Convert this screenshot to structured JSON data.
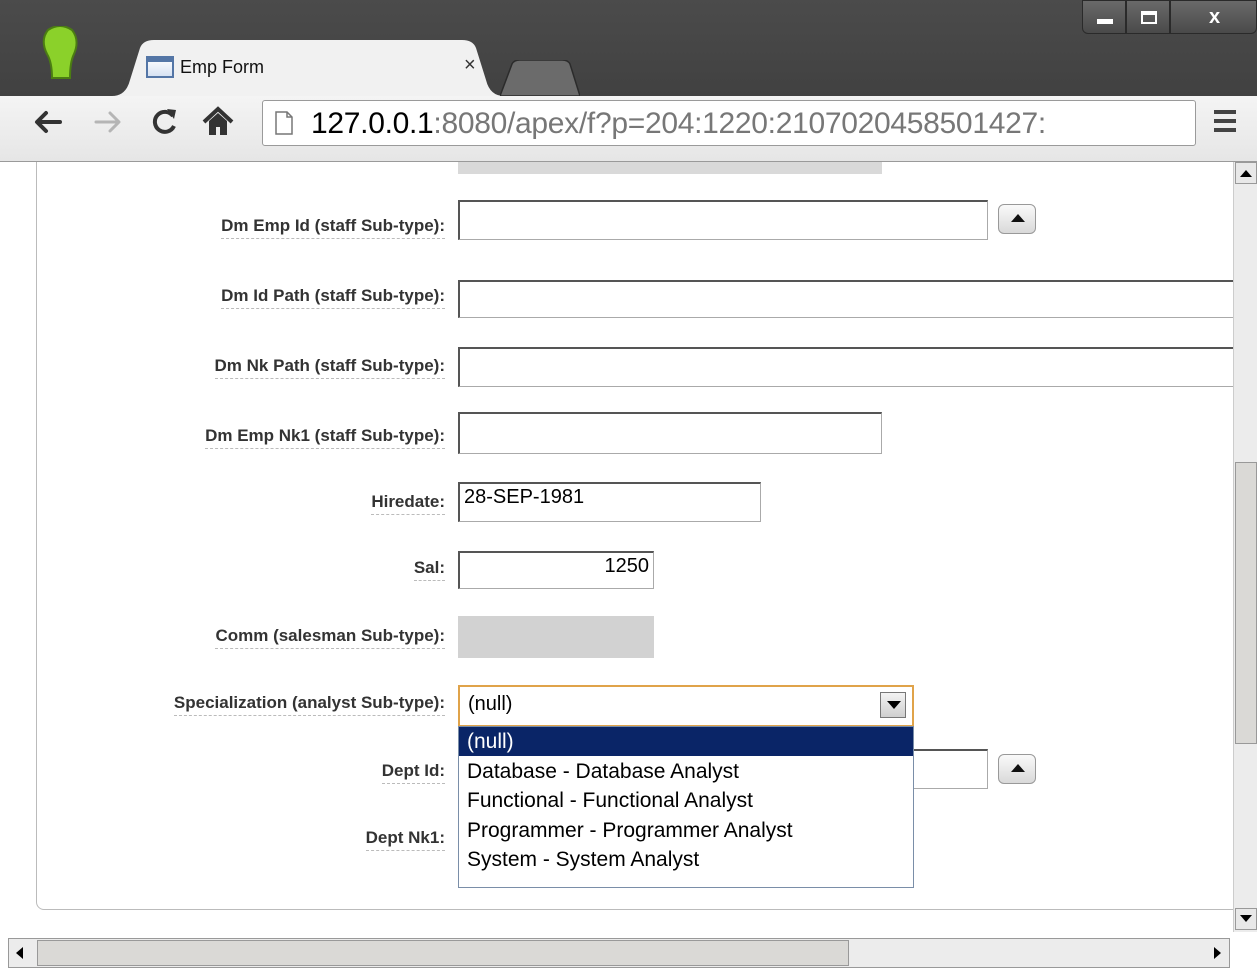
{
  "browser": {
    "tab": {
      "title": "Emp Form",
      "close_glyph": "×"
    },
    "address": {
      "host": "127.0.0.1",
      "rest": ":8080/apex/f?p=204:1220:2107020458501427:"
    },
    "window_controls": {
      "close_glyph": "x"
    },
    "icons": [
      "profile-icon",
      "page-icon",
      "back-icon",
      "forward-icon",
      "reload-icon",
      "home-icon",
      "star-icon",
      "menu-icon"
    ]
  },
  "form": {
    "dm_emp_id_label": "Dm Emp Id (staff Sub-type):",
    "dm_emp_id_value": "",
    "dm_id_path_label": "Dm Id Path (staff Sub-type):",
    "dm_id_path_value": "",
    "dm_nk_path_label": "Dm Nk Path (staff Sub-type):",
    "dm_nk_path_value": "",
    "dm_emp_nk1_label": "Dm Emp Nk1 (staff Sub-type):",
    "dm_emp_nk1_value": "",
    "hiredate_label": "Hiredate:",
    "hiredate_value": "28-SEP-1981",
    "sal_label": "Sal:",
    "sal_value": "1250",
    "comm_label": "Comm (salesman Sub-type):",
    "comm_value": "",
    "specialization_label": "Specialization (analyst Sub-type):",
    "specialization_value": "(null)",
    "specialization_options": [
      "(null)",
      "Database - Database Analyst",
      "Functional - Functional Analyst",
      "Programmer - Programmer Analyst",
      "System - System Analyst"
    ],
    "dept_id_label": "Dept Id:",
    "dept_nk1_label": "Dept Nk1:"
  },
  "colors": {
    "selected_option": "#0a2567",
    "select_focus_border": "#e0a34a",
    "label_text": "#333333"
  }
}
